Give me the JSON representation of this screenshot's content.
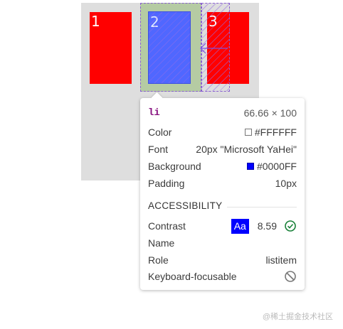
{
  "preview": {
    "items": [
      {
        "label": "1",
        "color": "#FF0000"
      },
      {
        "label": "2",
        "color": "#0000FF"
      },
      {
        "label": "3",
        "color": "#FF0000"
      }
    ]
  },
  "tooltip": {
    "element_tag": "li",
    "dimensions": "66.66 × 100",
    "rows": [
      {
        "label": "Color",
        "value": "#FFFFFF",
        "swatch": "#FFFFFF"
      },
      {
        "label": "Font",
        "value": "20px \"Microsoft YaHei\""
      },
      {
        "label": "Background",
        "value": "#0000FF",
        "swatch": "#0000FF"
      },
      {
        "label": "Padding",
        "value": "10px"
      }
    ],
    "accessibility": {
      "section_title": "ACCESSIBILITY",
      "contrast_label": "Contrast",
      "contrast_badge": "Aa",
      "contrast_value": "8.59",
      "contrast_icon": "check-circle-icon",
      "name_label": "Name",
      "name_value": "",
      "role_label": "Role",
      "role_value": "listitem",
      "focusable_label": "Keyboard-focusable",
      "focusable_icon": "no-entry-icon"
    }
  },
  "watermark": "@稀土掘金技术社区"
}
